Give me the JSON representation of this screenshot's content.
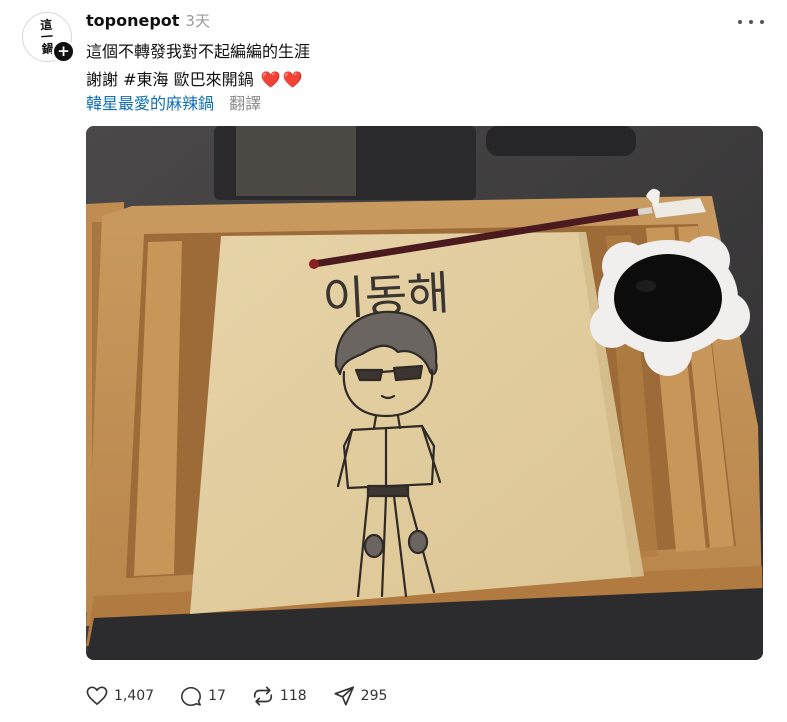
{
  "account": {
    "username": "toponepot",
    "timestamp": "3天",
    "avatar_text": "這一鍋",
    "follow_symbol": "+"
  },
  "caption": {
    "line1": "這個不轉發我對不起編編的生涯",
    "line2": "謝謝 #東海 歐巴來開鍋",
    "hearts": [
      "❤️",
      "❤️"
    ],
    "tag": "韓星最愛的麻辣鍋",
    "translate_label": "翻譯"
  },
  "image": {
    "drawn_text": "이동해"
  },
  "actions": {
    "likes": "1,407",
    "replies": "17",
    "reposts": "118",
    "shares": "295"
  },
  "icons": {
    "like": "heart-icon",
    "reply": "speech-bubble-icon",
    "repost": "repost-arrows-icon",
    "share": "send-icon",
    "more": "ellipsis-icon"
  },
  "colors": {
    "link": "#0f6fb5",
    "heart": "#e0143c",
    "muted": "#999999"
  }
}
